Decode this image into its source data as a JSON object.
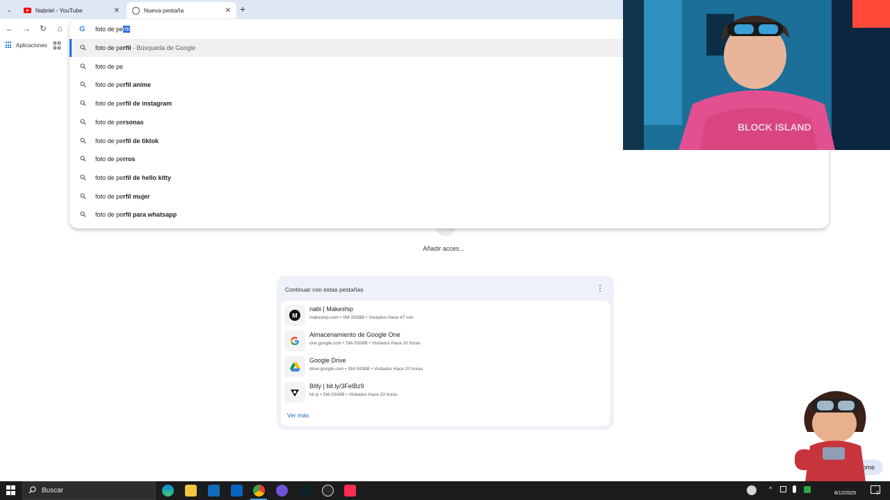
{
  "browser": {
    "tabs": [
      {
        "label": "Nabriel - YouTube",
        "active": false
      },
      {
        "label": "Nueva pestaña",
        "active": true
      }
    ],
    "tab_close": "✕",
    "new_tab": "+",
    "bookmarks": {
      "apps_label": "Aplicaciones"
    }
  },
  "omnibox": {
    "typed": "foto de pe",
    "autocomplete": "rfil",
    "suggestions": [
      {
        "typed": "foto de pe",
        "completion": "rfil",
        "extra": " - Búsqueda de Google"
      },
      {
        "typed": "foto de pe",
        "completion": "",
        "extra": ""
      },
      {
        "typed": "foto de pe",
        "completion": "rfil anime",
        "extra": ""
      },
      {
        "typed": "foto de pe",
        "completion": "rfil de instagram",
        "extra": ""
      },
      {
        "typed": "foto de pe",
        "completion": "rsonas",
        "extra": ""
      },
      {
        "typed": "foto de pe",
        "completion": "rfil de tiktok",
        "extra": ""
      },
      {
        "typed": "foto de pe",
        "completion": "rros",
        "extra": ""
      },
      {
        "typed": "foto de pe",
        "completion": "rfil de hello kitty",
        "extra": ""
      },
      {
        "typed": "foto de pe",
        "completion": "rfil mujer",
        "extra": ""
      },
      {
        "typed": "foto de pe",
        "completion": "rfil para whatsapp",
        "extra": ""
      }
    ]
  },
  "ntp": {
    "shortcut_label": "Añadir acces...",
    "continue_card": {
      "title": "Continuar con estas pestañas",
      "menu_icon": "⋮",
      "items": [
        {
          "title": "nabi | Makeship",
          "subtitle": "makeship.com • SM-S938B • Visitados Hace 47 min",
          "icon": "M"
        },
        {
          "title": "Almacenamiento de Google One",
          "subtitle": "one.google.com • SM-S938B • Visitados Hace 20 horas",
          "icon": "G"
        },
        {
          "title": "Google Drive",
          "subtitle": "drive.google.com • SM-S938B • Visitados Hace 20 horas",
          "icon": "drive"
        },
        {
          "title": "Bitly | bit.ly/3FelBz9",
          "subtitle": "bit.ly • SM-S938B • Visitados Hace 23 horas",
          "icon": "bitly"
        }
      ],
      "more_label": "Ver más"
    },
    "chrome_pill": "rome"
  },
  "taskbar": {
    "search_label": "Buscar",
    "date": "8/12/2025",
    "notification_count": "2"
  }
}
